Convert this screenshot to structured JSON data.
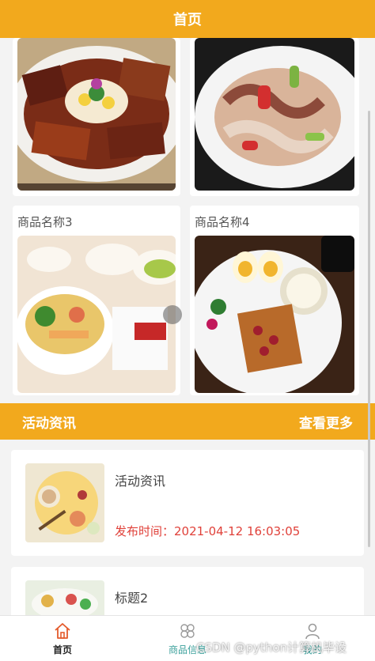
{
  "header": {
    "title": "首页"
  },
  "products": [
    {
      "name": "",
      "image": "braised-meat-platter"
    },
    {
      "name": "",
      "image": "squid-pepper-dish"
    },
    {
      "name": "商品名称3",
      "image": "noodle-bowl-dishes"
    },
    {
      "name": "商品名称4",
      "image": "waffle-breakfast-plate"
    }
  ],
  "news_section": {
    "title": "活动资讯",
    "more": "查看更多"
  },
  "news": [
    {
      "title": "活动资讯",
      "time": "发布时间：2021-04-12 16:03:05",
      "image": "tea-snack-plate"
    },
    {
      "title": "标题2",
      "time": "",
      "image": "dish-plate"
    }
  ],
  "tabs": [
    {
      "label": "首页",
      "icon": "home-icon",
      "active": true
    },
    {
      "label": "商品信息",
      "icon": "flower-icon",
      "active": false
    },
    {
      "label": "我的",
      "icon": "user-icon",
      "active": false
    }
  ],
  "watermark": "CSDN @python计算机毕设",
  "colors": {
    "accent": "#f2a91d",
    "time": "#e0413a",
    "tab_active": "#e45b2c"
  }
}
